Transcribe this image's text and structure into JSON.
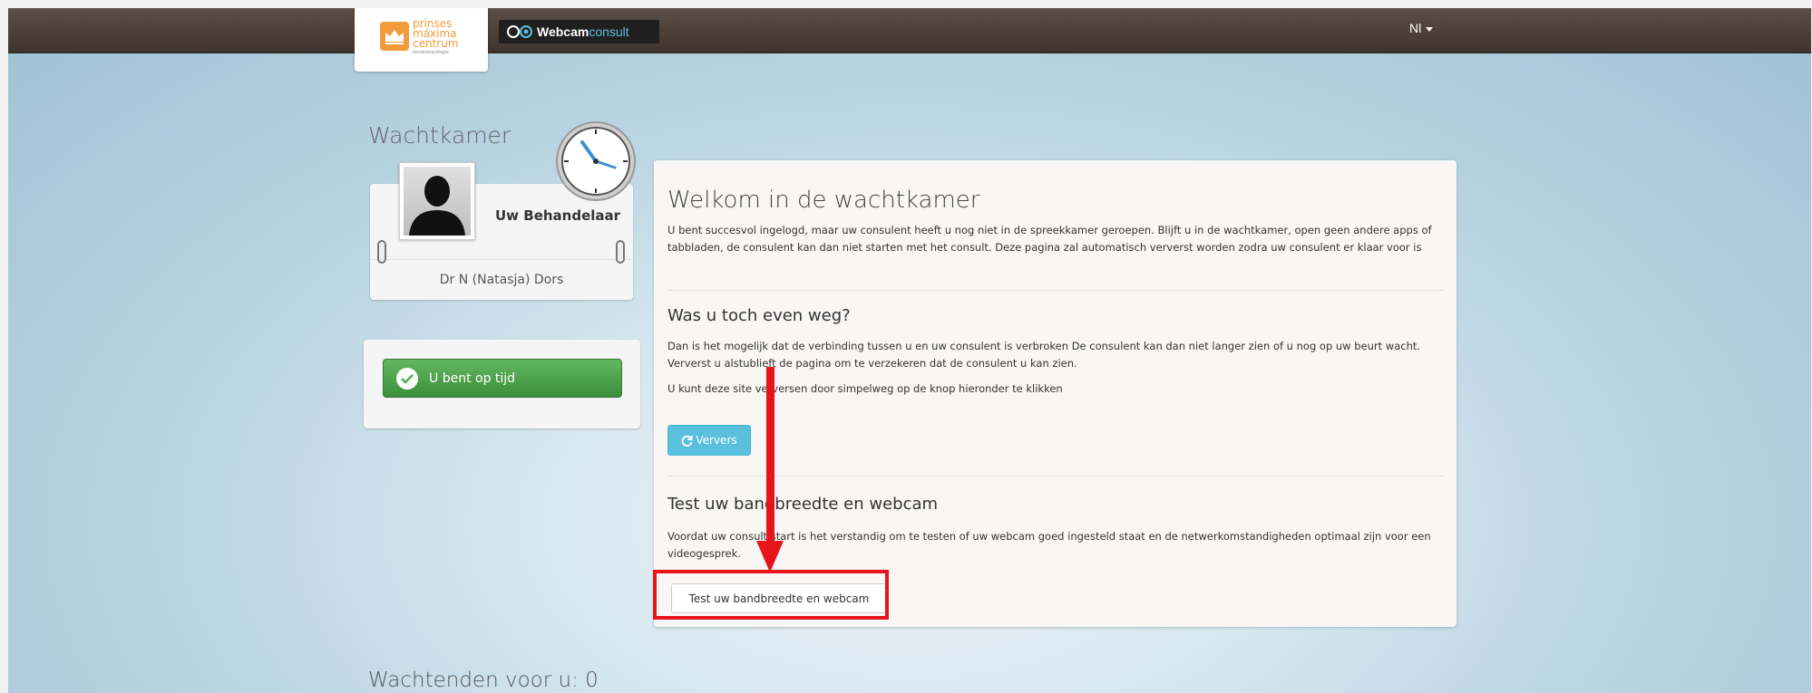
{
  "header": {
    "logo_name": "prinses máxima centrum",
    "logo_sub": "kinderoncologie",
    "app_name_bold": "Webcam",
    "app_name_light": "consult",
    "language": "Nl"
  },
  "waiting_room": {
    "title": "Wachtkamer",
    "practitioner_label": "Uw Behandelaar",
    "practitioner_name": "Dr N (Natasja) Dors",
    "status": "U bent op tijd"
  },
  "main": {
    "title": "Welkom in de wachtkamer",
    "intro": "U bent succesvol ingelogd, maar uw consulent heeft u nog niet in de spreekkamer geroepen. Blijft u in de wachtkamer, open geen andere apps of tabbladen, de consulent kan dan niet starten met het consult. Deze pagina zal automatisch ververst worden zodra uw consulent er klaar voor is",
    "away_title": "Was u toch even weg?",
    "away_text": "Dan is het mogelijk dat de verbinding tussen u en uw consulent is verbroken De consulent kan dan niet langer zien of u nog op uw beurt wacht. Ververst u alstublieft de pagina om te verzekeren dat de consulent u kan zien.",
    "away_text2": "U kunt deze site verversen door simpelweg op de knop hieronder te klikken",
    "refresh_button": "Ververs",
    "test_title": "Test uw bandbreedte en webcam",
    "test_text": "Voordat uw consult start is het verstandig om te testen of uw webcam goed ingesteld staat en de netwerkomstandigheden optimaal zijn voor een videogesprek.",
    "test_button": "Test uw bandbreedte en webcam"
  },
  "queue": {
    "label": "Wachtenden voor u: 0"
  },
  "colors": {
    "topbar": "#4a3e36",
    "accent_orange": "#f39a3b",
    "refresh_blue": "#5bc0de",
    "status_green": "#4cae4c",
    "annotation_red": "#e8141b"
  }
}
